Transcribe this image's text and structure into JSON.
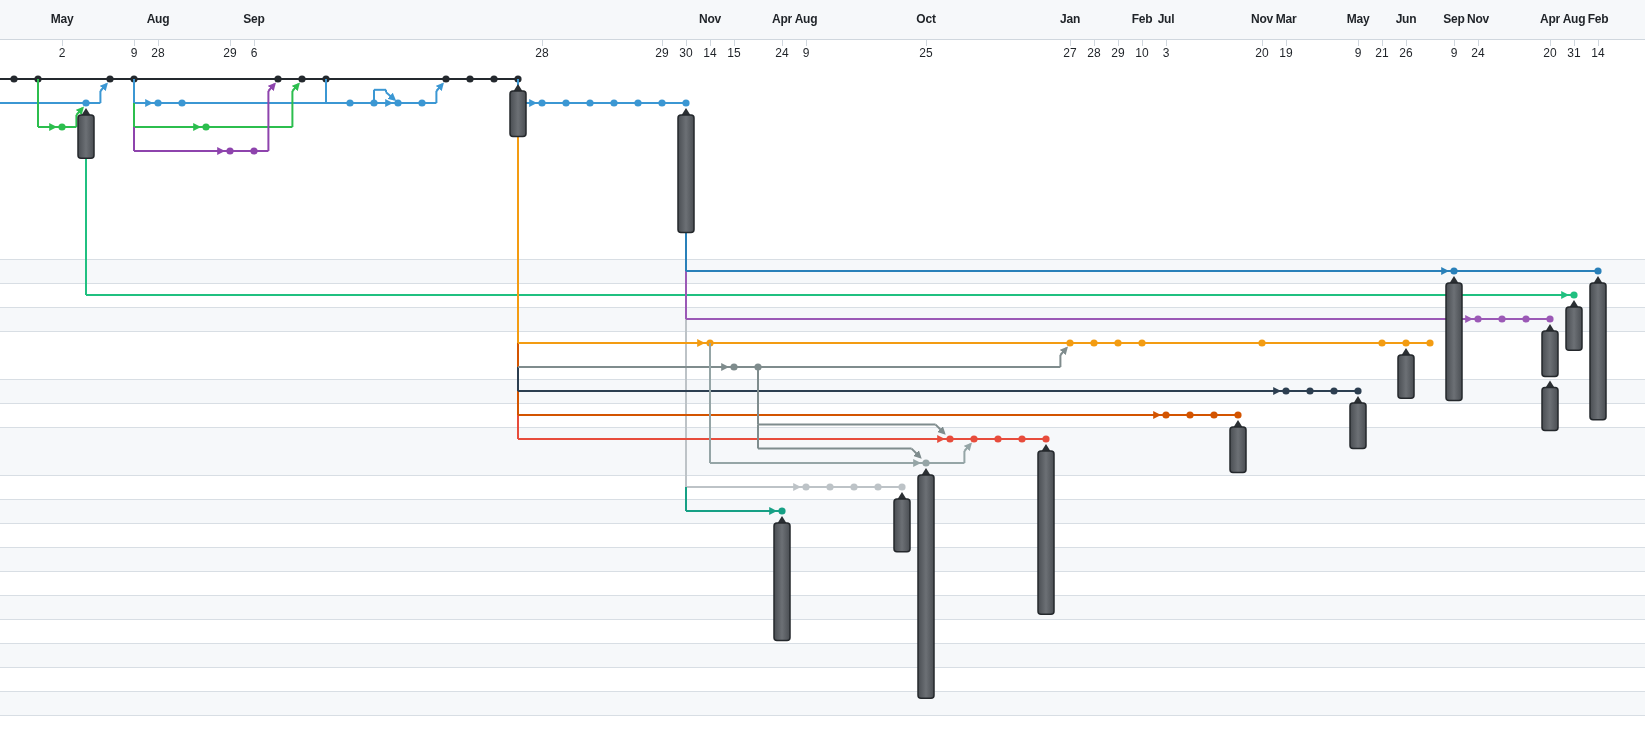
{
  "timeline": {
    "months": [
      "May",
      "Aug",
      "Sep",
      "Nov",
      "Apr",
      "Aug",
      "Oct",
      "Jan",
      "Feb",
      "Jul",
      "Nov",
      "Mar",
      "May",
      "Jun",
      "Sep",
      "Nov",
      "Apr",
      "Aug",
      "Feb"
    ],
    "days": [
      "2",
      "9",
      "28",
      "29",
      "6",
      "28",
      "29",
      "30",
      "14",
      "15",
      "24",
      "9",
      "25",
      "27",
      "28",
      "29",
      "10",
      "3",
      "20",
      "19",
      "9",
      "21",
      "26",
      "9",
      "24",
      "20",
      "31",
      "14"
    ]
  }
}
